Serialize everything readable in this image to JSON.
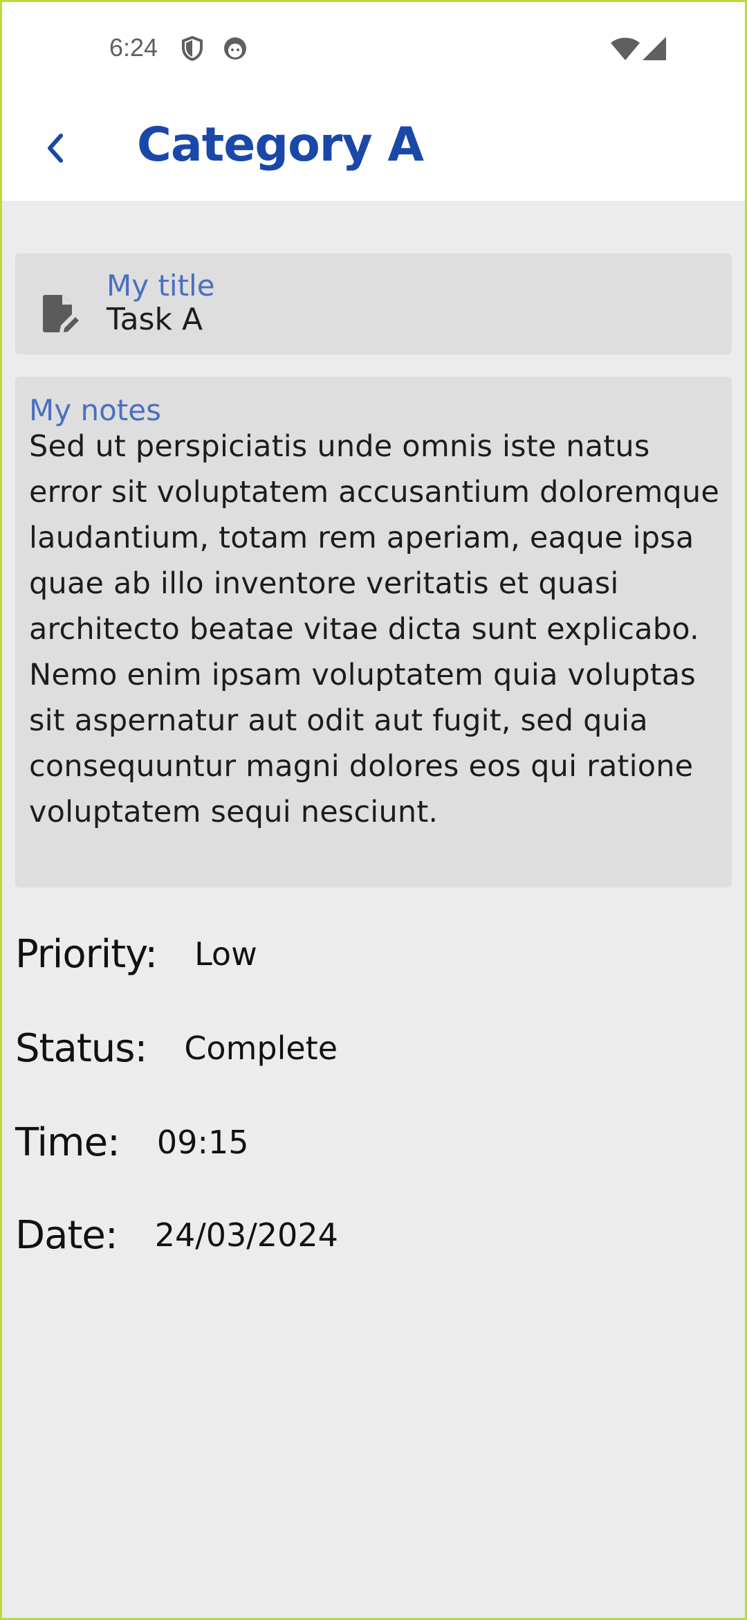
{
  "status_bar": {
    "time": "6:24",
    "icons": [
      "shield-icon",
      "face-icon",
      "wifi-icon",
      "signal-icon"
    ]
  },
  "app_bar": {
    "back_icon": "chevron-left-icon",
    "title": "Category A"
  },
  "task": {
    "title_label": "My title",
    "title_value": "Task A",
    "title_icon": "edit-document-icon",
    "notes_label": "My notes",
    "notes_value": "Sed ut perspiciatis unde omnis iste natus error sit voluptatem accusantium doloremque laudantium, totam rem aperiam, eaque ipsa quae ab illo inventore veritatis et quasi architecto beatae vitae dicta sunt explicabo. Nemo enim ipsam voluptatem quia voluptas sit aspernatur aut odit aut fugit, sed quia consequuntur magni dolores eos qui ratione voluptatem sequi nesciunt."
  },
  "details": {
    "priority_label": "Priority:",
    "priority_value": "Low",
    "status_label": "Status:",
    "status_value": "Complete",
    "time_label": "Time:",
    "time_value": "09:15",
    "date_label": "Date:",
    "date_value": "24/03/2024"
  },
  "colors": {
    "accent": "#1a48a8",
    "label": "#4a6fbf",
    "card_bg": "#dedede",
    "page_bg": "#ececec"
  }
}
